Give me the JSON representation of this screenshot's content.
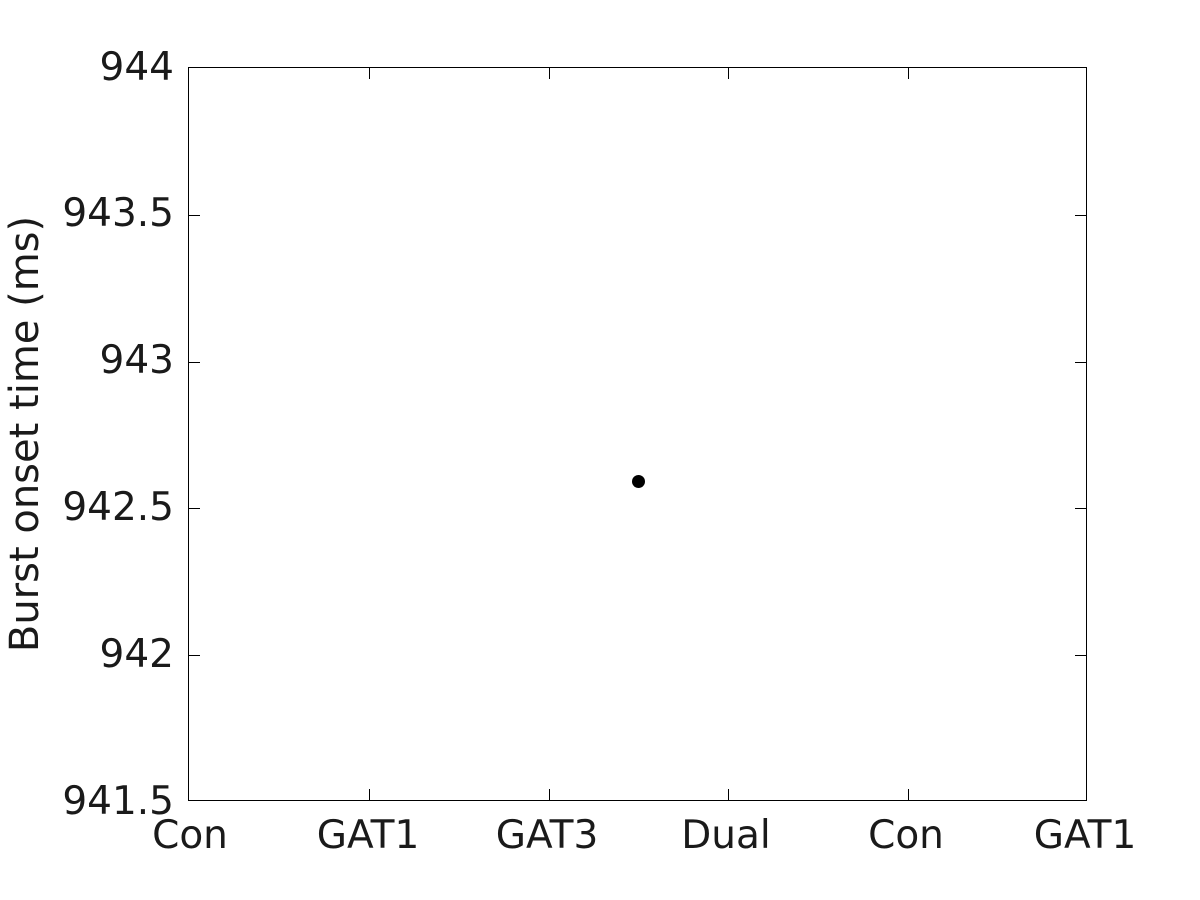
{
  "figure": {
    "background_color": "#ffffff",
    "axis_color": "#000000",
    "text_color": "#1a1a1a",
    "marker_color": "#000000",
    "ylabel": "Burst onset time (ms)"
  },
  "chart_data": {
    "type": "scatter",
    "title": "",
    "xlabel": "",
    "ylabel": "Burst onset time (ms)",
    "categories": [
      "Con",
      "GAT1",
      "GAT3",
      "Dual",
      "Con",
      "GAT1"
    ],
    "xtick_labels": [
      "Con",
      "GAT1",
      "GAT3",
      "Dual",
      "Con",
      "GAT1"
    ],
    "xtick_values": [
      1,
      2,
      3,
      4,
      5,
      6
    ],
    "ytick_labels": [
      "941.5",
      "942",
      "942.5",
      "943",
      "943.5",
      "944"
    ],
    "ytick_values": [
      941.5,
      942,
      942.5,
      943,
      943.5,
      944
    ],
    "xlim": [
      0.5,
      6.5
    ],
    "ylim": [
      941.5,
      944
    ],
    "grid": false,
    "legend": null,
    "series": [
      {
        "name": "Burst onset time",
        "marker": "filled-circle",
        "color": "#000000",
        "points": [
          {
            "x": 3.5,
            "y": 942.59,
            "category": "GAT3-Dual"
          }
        ]
      }
    ],
    "notes": "Single data point plotted; all other category positions have no data."
  }
}
